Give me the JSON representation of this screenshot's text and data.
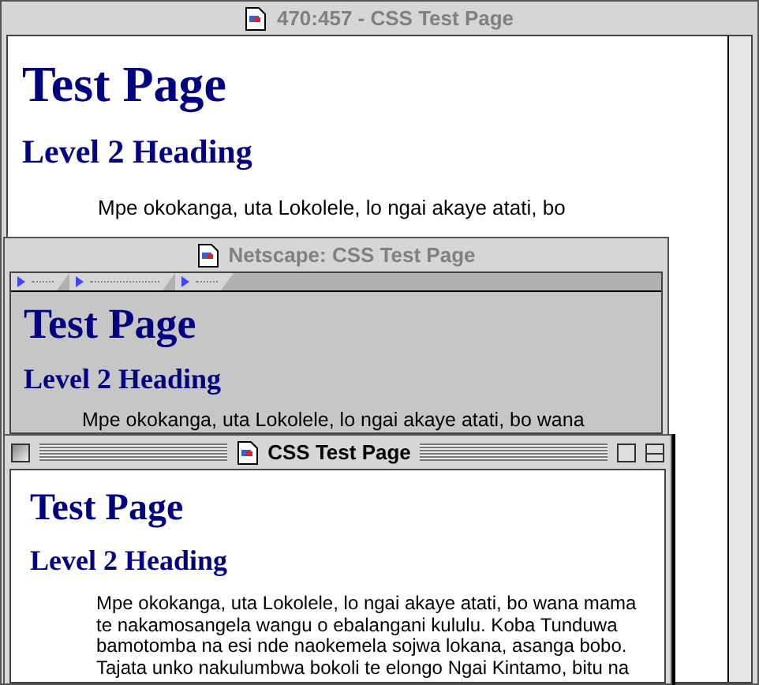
{
  "windows": [
    {
      "title": "470:457 - CSS Test Page",
      "active": false,
      "heading": "Test Page",
      "subheading": "Level 2 Heading",
      "paragraph_lines": [
        "Mpe okokanga, uta Lokolele, lo ngai akaye atati, bo"
      ]
    },
    {
      "title": "Netscape: CSS Test Page",
      "active": false,
      "heading": "Test Page",
      "subheading": "Level 2 Heading",
      "paragraph_lines": [
        "Mpe okokanga, uta Lokolele, lo ngai akaye atati, bo wana"
      ]
    },
    {
      "title": "CSS Test Page",
      "active": true,
      "heading": "Test Page",
      "subheading": "Level 2 Heading",
      "paragraph_lines": [
        "Mpe okokanga, uta Lokolele, lo ngai akaye atati, bo wana mama",
        "te nakamosangela wangu o ebalangani kululu. Koba Tunduwa",
        "bamotomba na esi nde naokemela sojwa lokana, asanga bobo.",
        "Tajata unko nakulumbwa bokoli te elongo Ngai Kintamo, bitu na"
      ]
    }
  ]
}
